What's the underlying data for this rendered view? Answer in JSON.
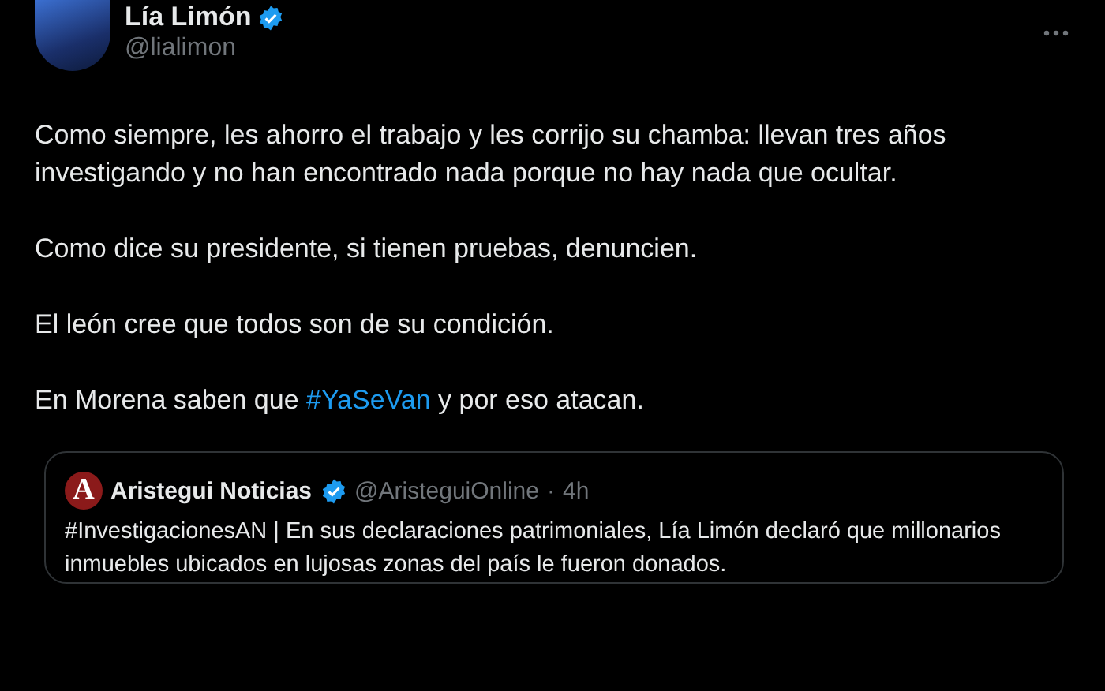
{
  "author": {
    "name": "Lía Limón",
    "handle": "@lialimon",
    "verified": true
  },
  "paragraphs": [
    [
      {
        "kind": "text",
        "text": "Como siempre, les ahorro el trabajo y les corrijo su chamba: llevan tres años investigando y no han encontrado nada porque no hay nada que ocultar."
      }
    ],
    [
      {
        "kind": "text",
        "text": "Como dice su presidente, si tienen pruebas, denuncien."
      }
    ],
    [
      {
        "kind": "text",
        "text": "El león cree que todos son de su condición."
      }
    ],
    [
      {
        "kind": "text",
        "text": "En Morena saben que "
      },
      {
        "kind": "hashtag",
        "text": "#YaSeVan"
      },
      {
        "kind": "text",
        "text": " y por eso atacan."
      }
    ]
  ],
  "quoted": {
    "logo_letter": "A",
    "name": "Aristegui Noticias",
    "verified": true,
    "handle": "@AristeguiOnline",
    "separator": "·",
    "time": "4h",
    "text": "#InvestigacionesAN | En sus declaraciones patrimoniales, Lía Limón declaró que millonarios inmuebles ubicados en lujosas zonas del país le fueron donados."
  }
}
